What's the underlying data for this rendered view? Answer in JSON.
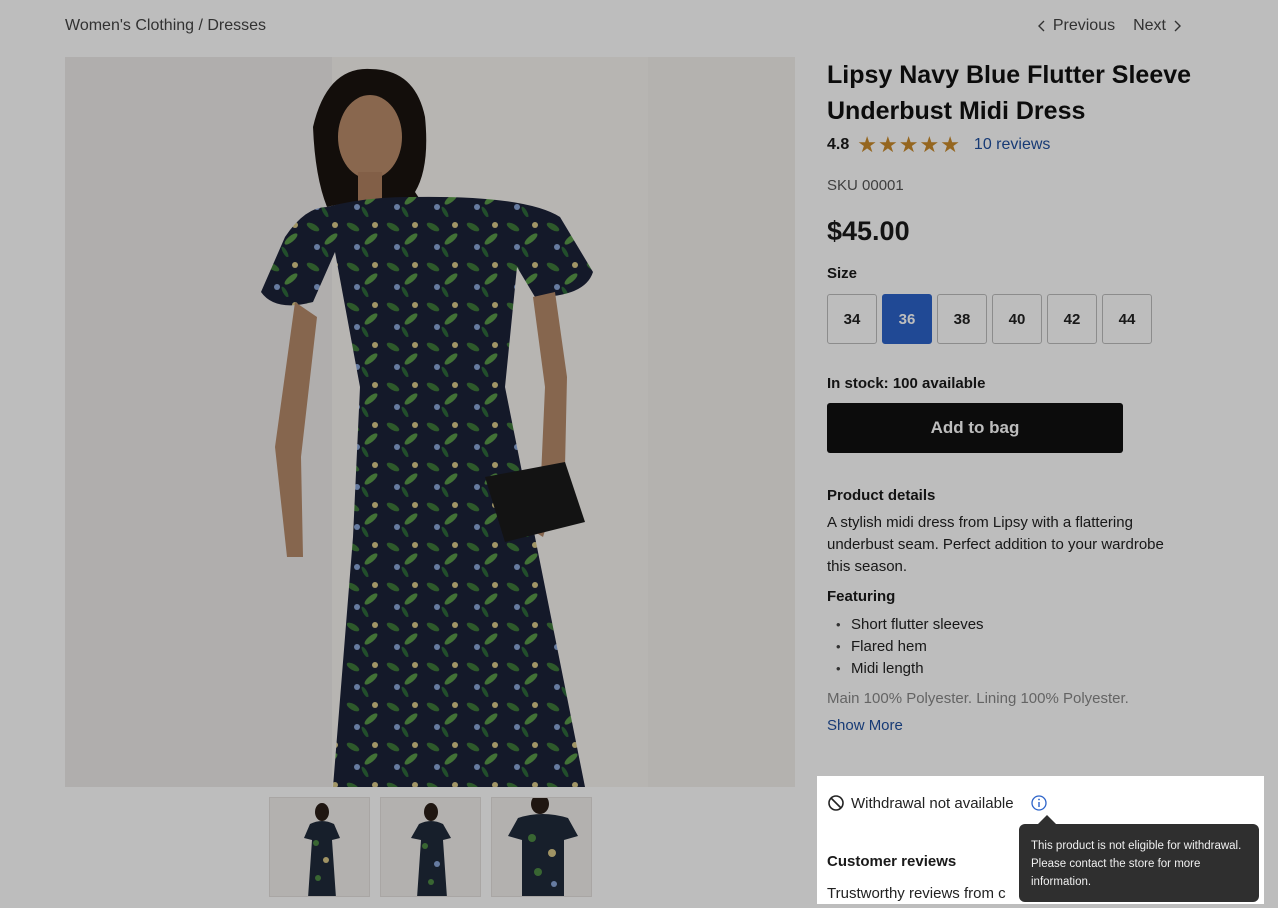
{
  "breadcrumb": "Women's Clothing / Dresses",
  "pager": {
    "previous": "Previous",
    "next": "Next"
  },
  "product": {
    "title": "Lipsy Navy Blue Flutter Sleeve Underbust Midi Dress",
    "rating": "4.8",
    "stars_filled": 5,
    "reviews_link": "10 reviews",
    "sku": "SKU 00001",
    "price": "$45.00",
    "size_label": "Size",
    "sizes": [
      "34",
      "36",
      "38",
      "40",
      "42",
      "44"
    ],
    "selected_size": "36",
    "stock": "In stock: 100 available",
    "add_to_bag": "Add to bag",
    "details_heading": "Product details",
    "description": "A stylish midi dress from Lipsy with a flattering underbust seam. Perfect addition to your wardrobe this season.",
    "featuring_heading": "Featuring",
    "features": [
      "Short flutter sleeves",
      "Flared hem",
      "Midi length"
    ],
    "material": "Main 100% Polyester. Lining 100% Polyester.",
    "show_more": "Show More"
  },
  "withdrawal": {
    "label": "Withdrawal not available",
    "tooltip": "This product is not eligible for withdrawal. Please contact the store for more information."
  },
  "reviews_section": {
    "heading": "Customer reviews",
    "subtext": "Trustworthy reviews from c"
  },
  "colors": {
    "accent": "#2c63c9",
    "link": "#1f4f9e",
    "star": "#c98a2a",
    "button": "#111111",
    "tooltip_bg": "#2f2f2f"
  }
}
